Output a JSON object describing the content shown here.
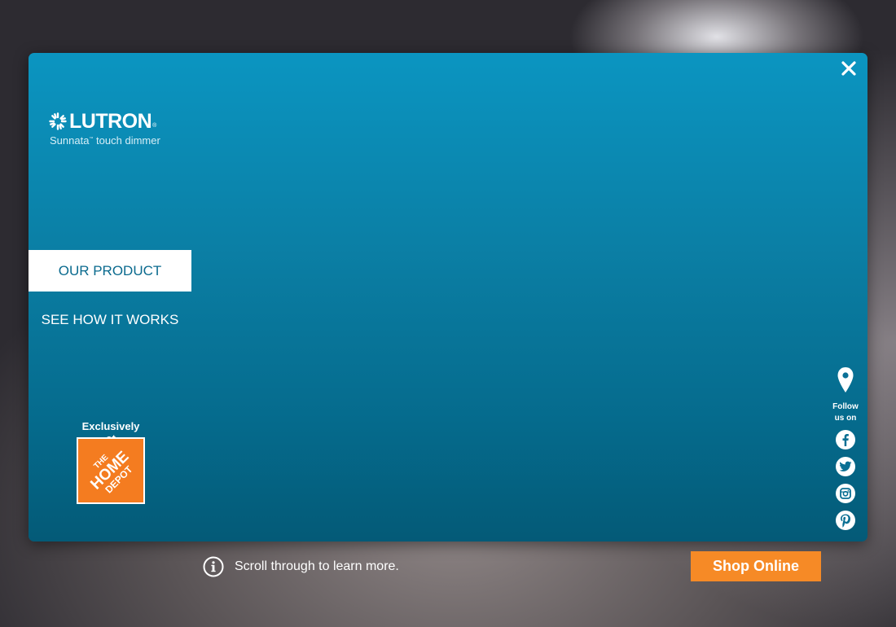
{
  "brand": {
    "logo_text": "LUTRON",
    "logo_reg": "®",
    "product_name": "Sunnata",
    "product_tm": "™",
    "product_rest": " touch dimmer"
  },
  "nav": {
    "our_product": "OUR PRODUCT",
    "see_how_it_works": "SEE HOW IT WORKS"
  },
  "retailer": {
    "label": "Exclusively at",
    "logo_lines": [
      "THE",
      "HOME",
      "DEPOT"
    ]
  },
  "social": {
    "follow_label_1": "Follow",
    "follow_label_2": "us on",
    "icons": [
      "location-pin-icon",
      "facebook-icon",
      "twitter-icon",
      "instagram-icon",
      "pinterest-icon"
    ]
  },
  "footer": {
    "info_text": "Scroll through to learn more.",
    "shop_label": "Shop Online"
  },
  "colors": {
    "panel_top": "#0b95c1",
    "panel_bottom": "#045a77",
    "shop_button": "#f68a26",
    "home_depot_orange": "#f47c20"
  }
}
